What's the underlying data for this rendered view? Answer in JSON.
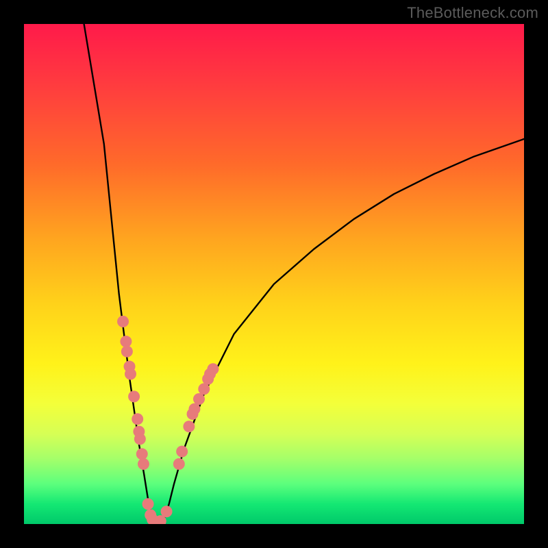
{
  "watermark": "TheBottleneck.com",
  "chart_data": {
    "type": "line",
    "title": "",
    "xlabel": "",
    "ylabel": "",
    "xlim": [
      0,
      100
    ],
    "ylim": [
      0,
      100
    ],
    "series": [
      {
        "name": "bottleneck-curve",
        "x": [
          12,
          14,
          16,
          17,
          18,
          19,
          20,
          21,
          22,
          23,
          24,
          24.8,
          25.5,
          26,
          26.5,
          27,
          28,
          29,
          30,
          32,
          36,
          42,
          50,
          58,
          66,
          74,
          82,
          90,
          100
        ],
        "y": [
          100,
          88,
          76,
          66,
          56,
          46,
          38,
          30,
          23,
          16,
          10,
          5,
          2,
          0.6,
          0.3,
          0.5,
          1,
          4,
          8,
          15,
          26,
          38,
          48,
          55,
          61,
          66,
          70,
          73.5,
          77
        ]
      }
    ],
    "markers": {
      "name": "highlight-dots",
      "color": "#e77b7b",
      "points": [
        {
          "x": 19.8,
          "y": 40.5
        },
        {
          "x": 20.4,
          "y": 36.5
        },
        {
          "x": 20.6,
          "y": 34.5
        },
        {
          "x": 21.1,
          "y": 31.5
        },
        {
          "x": 21.3,
          "y": 30.0
        },
        {
          "x": 22.0,
          "y": 25.5
        },
        {
          "x": 22.7,
          "y": 21.0
        },
        {
          "x": 23.0,
          "y": 18.5
        },
        {
          "x": 23.2,
          "y": 17.0
        },
        {
          "x": 23.6,
          "y": 14.0
        },
        {
          "x": 23.9,
          "y": 12.0
        },
        {
          "x": 24.8,
          "y": 4.0
        },
        {
          "x": 25.3,
          "y": 1.8
        },
        {
          "x": 25.7,
          "y": 0.9
        },
        {
          "x": 26.2,
          "y": 0.4
        },
        {
          "x": 26.7,
          "y": 0.3
        },
        {
          "x": 27.3,
          "y": 0.6
        },
        {
          "x": 28.5,
          "y": 2.5
        },
        {
          "x": 31.0,
          "y": 12.0
        },
        {
          "x": 31.6,
          "y": 14.5
        },
        {
          "x": 33.0,
          "y": 19.5
        },
        {
          "x": 33.7,
          "y": 22.0
        },
        {
          "x": 34.1,
          "y": 23.0
        },
        {
          "x": 35.0,
          "y": 25.0
        },
        {
          "x": 36.0,
          "y": 27.0
        },
        {
          "x": 36.8,
          "y": 29.0
        },
        {
          "x": 37.2,
          "y": 30.0
        },
        {
          "x": 37.8,
          "y": 31.0
        }
      ]
    }
  }
}
